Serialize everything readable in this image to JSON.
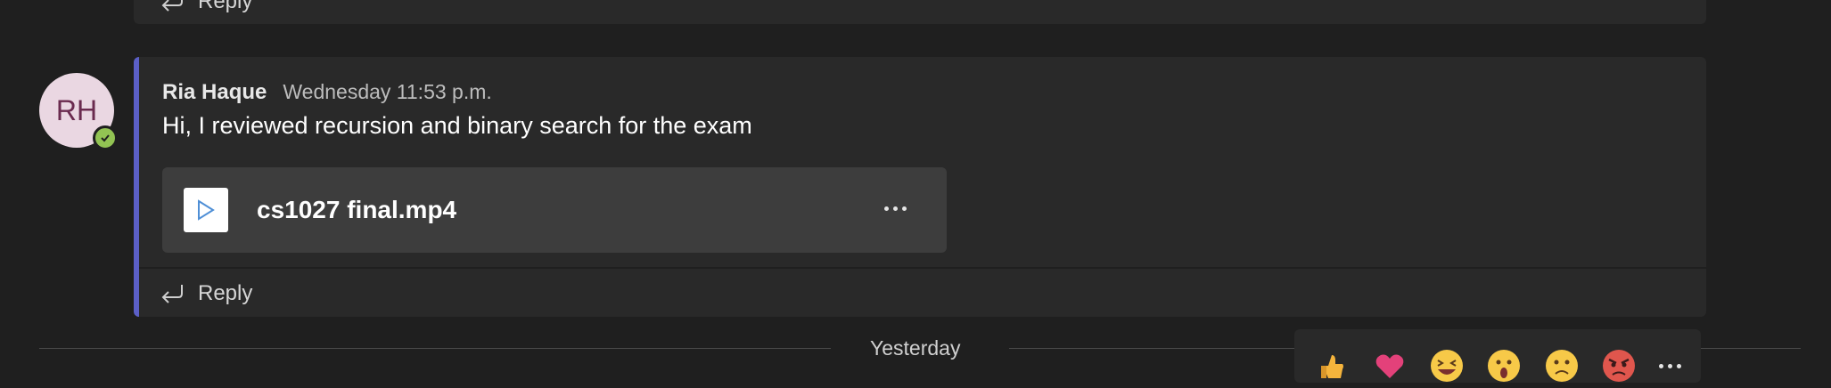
{
  "previous_message": {
    "reply_label": "Reply"
  },
  "message": {
    "avatar_initials": "RH",
    "sender": "Ria Haque",
    "timestamp": "Wednesday 11:53 p.m.",
    "body": "Hi, I reviewed recursion and binary search for the exam",
    "attachment": {
      "file_name": "cs1027 final.mp4",
      "icon": "video-play-icon"
    },
    "reply_label": "Reply"
  },
  "day_divider": {
    "label": "Yesterday"
  },
  "reactions": [
    {
      "name": "like",
      "icon": "thumbs-up-icon",
      "color": "#f5b43c"
    },
    {
      "name": "heart",
      "icon": "heart-icon",
      "color": "#e3417a"
    },
    {
      "name": "laugh",
      "icon": "laugh-icon",
      "color": "#f7c948"
    },
    {
      "name": "surprised",
      "icon": "surprised-icon",
      "color": "#f7c948"
    },
    {
      "name": "sad",
      "icon": "sad-icon",
      "color": "#f7c948"
    },
    {
      "name": "angry",
      "icon": "angry-icon",
      "color": "#e0564d"
    }
  ],
  "colors": {
    "accent": "#5b5fc7",
    "presence": "#92c353",
    "background": "#1f1f1f",
    "card": "#292929"
  }
}
